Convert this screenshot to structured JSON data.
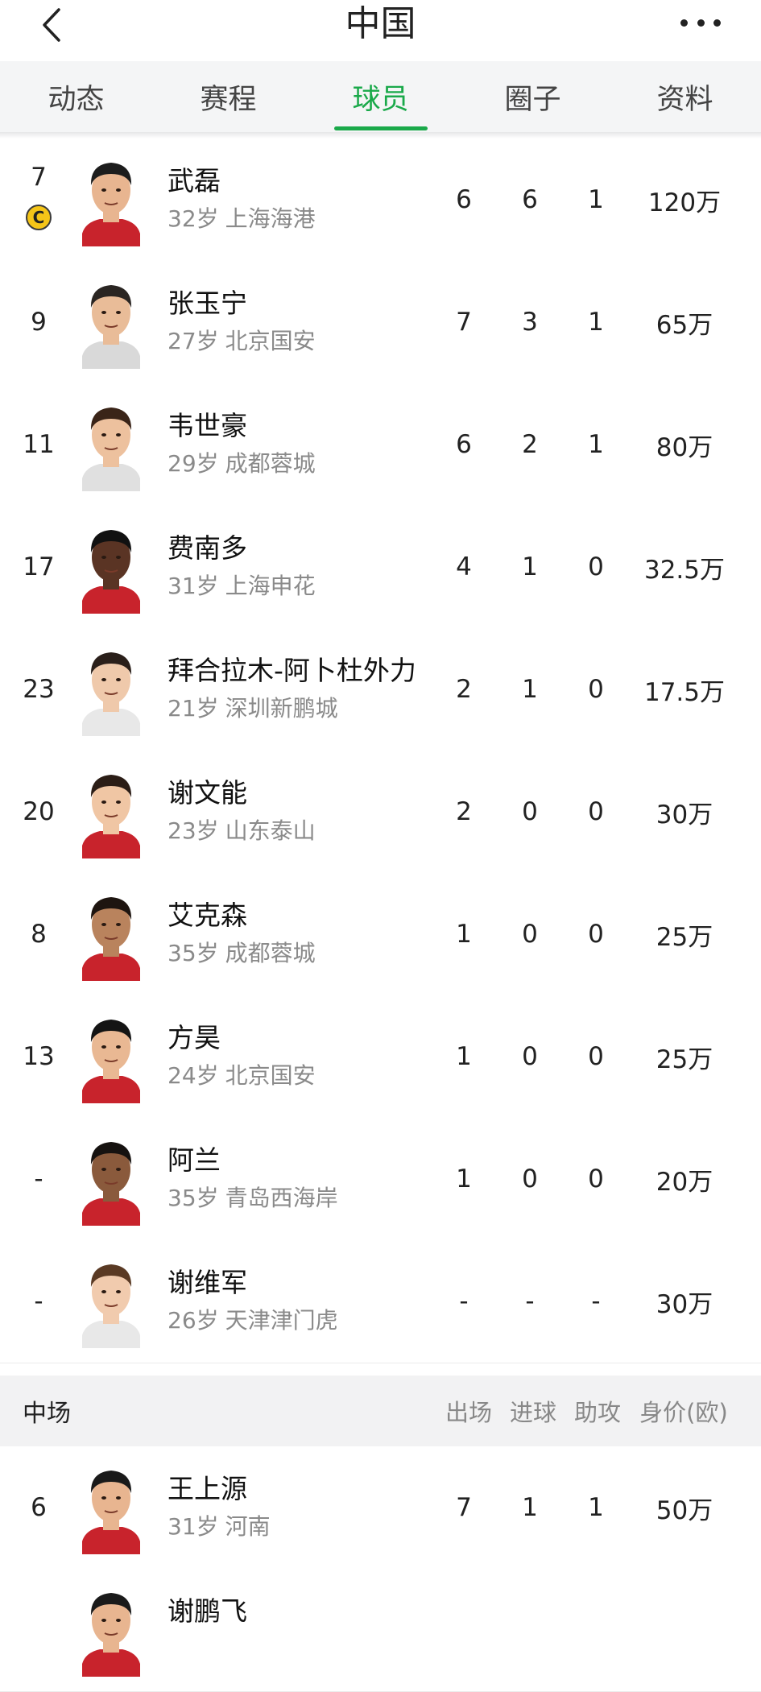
{
  "header": {
    "title": "中国"
  },
  "tabs": [
    {
      "label": "动态",
      "active": false
    },
    {
      "label": "赛程",
      "active": false
    },
    {
      "label": "球员",
      "active": true
    },
    {
      "label": "圈子",
      "active": false
    },
    {
      "label": "资料",
      "active": false
    }
  ],
  "players": [
    {
      "number": "7",
      "captain": true,
      "name": "武磊",
      "age": "32岁",
      "club": "上海海港",
      "apps": "6",
      "goals": "6",
      "assists": "1",
      "value": "120万",
      "skin": "#e8b590",
      "hair": "#1c1c1c",
      "shirt": "#c8232c"
    },
    {
      "number": "9",
      "captain": false,
      "name": "张玉宁",
      "age": "27岁",
      "club": "北京国安",
      "apps": "7",
      "goals": "3",
      "assists": "1",
      "value": "65万",
      "skin": "#e9bc98",
      "hair": "#2a2522",
      "shirt": "#d9d9d9"
    },
    {
      "number": "11",
      "captain": false,
      "name": "韦世豪",
      "age": "29岁",
      "club": "成都蓉城",
      "apps": "6",
      "goals": "2",
      "assists": "1",
      "value": "80万",
      "skin": "#edc19e",
      "hair": "#3a2418",
      "shirt": "#e0e0e0"
    },
    {
      "number": "17",
      "captain": false,
      "name": "费南多",
      "age": "31岁",
      "club": "上海申花",
      "apps": "4",
      "goals": "1",
      "assists": "0",
      "value": "32.5万",
      "skin": "#5a3424",
      "hair": "#111111",
      "shirt": "#c8232c"
    },
    {
      "number": "23",
      "captain": false,
      "name": "拜合拉木-阿卜杜外力",
      "age": "21岁",
      "club": "深圳新鹏城",
      "apps": "2",
      "goals": "1",
      "assists": "0",
      "value": "17.5万",
      "skin": "#efc9ab",
      "hair": "#2a1f1a",
      "shirt": "#e8e8e8"
    },
    {
      "number": "20",
      "captain": false,
      "name": "谢文能",
      "age": "23岁",
      "club": "山东泰山",
      "apps": "2",
      "goals": "0",
      "assists": "0",
      "value": "30万",
      "skin": "#f0c6a4",
      "hair": "#2b1d16",
      "shirt": "#c8232c"
    },
    {
      "number": "8",
      "captain": false,
      "name": "艾克森",
      "age": "35岁",
      "club": "成都蓉城",
      "apps": "1",
      "goals": "0",
      "assists": "0",
      "value": "25万",
      "skin": "#b9835d",
      "hair": "#1e1510",
      "shirt": "#c8232c"
    },
    {
      "number": "13",
      "captain": false,
      "name": "方昊",
      "age": "24岁",
      "club": "北京国安",
      "apps": "1",
      "goals": "0",
      "assists": "0",
      "value": "25万",
      "skin": "#e9b893",
      "hair": "#141414",
      "shirt": "#c8232c"
    },
    {
      "number": "-",
      "captain": false,
      "name": "阿兰",
      "age": "35岁",
      "club": "青岛西海岸",
      "apps": "1",
      "goals": "0",
      "assists": "0",
      "value": "20万",
      "skin": "#8a5a3c",
      "hair": "#161210",
      "shirt": "#c8232c"
    },
    {
      "number": "-",
      "captain": false,
      "name": "谢维军",
      "age": "26岁",
      "club": "天津津门虎",
      "apps": "-",
      "goals": "-",
      "assists": "-",
      "value": "30万",
      "skin": "#f1cbae",
      "hair": "#5a3a24",
      "shirt": "#e8e8e8"
    }
  ],
  "midfield_section": {
    "label": "中场",
    "headers": {
      "apps": "出场",
      "goals": "进球",
      "assists": "助攻",
      "value": "身价(欧)"
    }
  },
  "midfielders": [
    {
      "number": "6",
      "captain": false,
      "name": "王上源",
      "age": "31岁",
      "club": "河南",
      "apps": "7",
      "goals": "1",
      "assists": "1",
      "value": "50万",
      "skin": "#e8b590",
      "hair": "#1a1a1a",
      "shirt": "#c8232c"
    },
    {
      "number": "",
      "captain": false,
      "name": "谢鹏飞",
      "age": "",
      "club": "",
      "apps": "",
      "goals": "",
      "assists": "",
      "value": "",
      "skin": "#e8b590",
      "hair": "#1a1a1a",
      "shirt": "#c8232c"
    }
  ],
  "colors": {
    "accent": "#1aa94a",
    "captain": "#f5c518",
    "muted_text": "#8a8a8a",
    "tab_bg": "#f4f5f6"
  },
  "icons": {
    "back": "chevron-left-icon",
    "more": "more-dots-icon",
    "captain": "captain-badge-icon"
  }
}
